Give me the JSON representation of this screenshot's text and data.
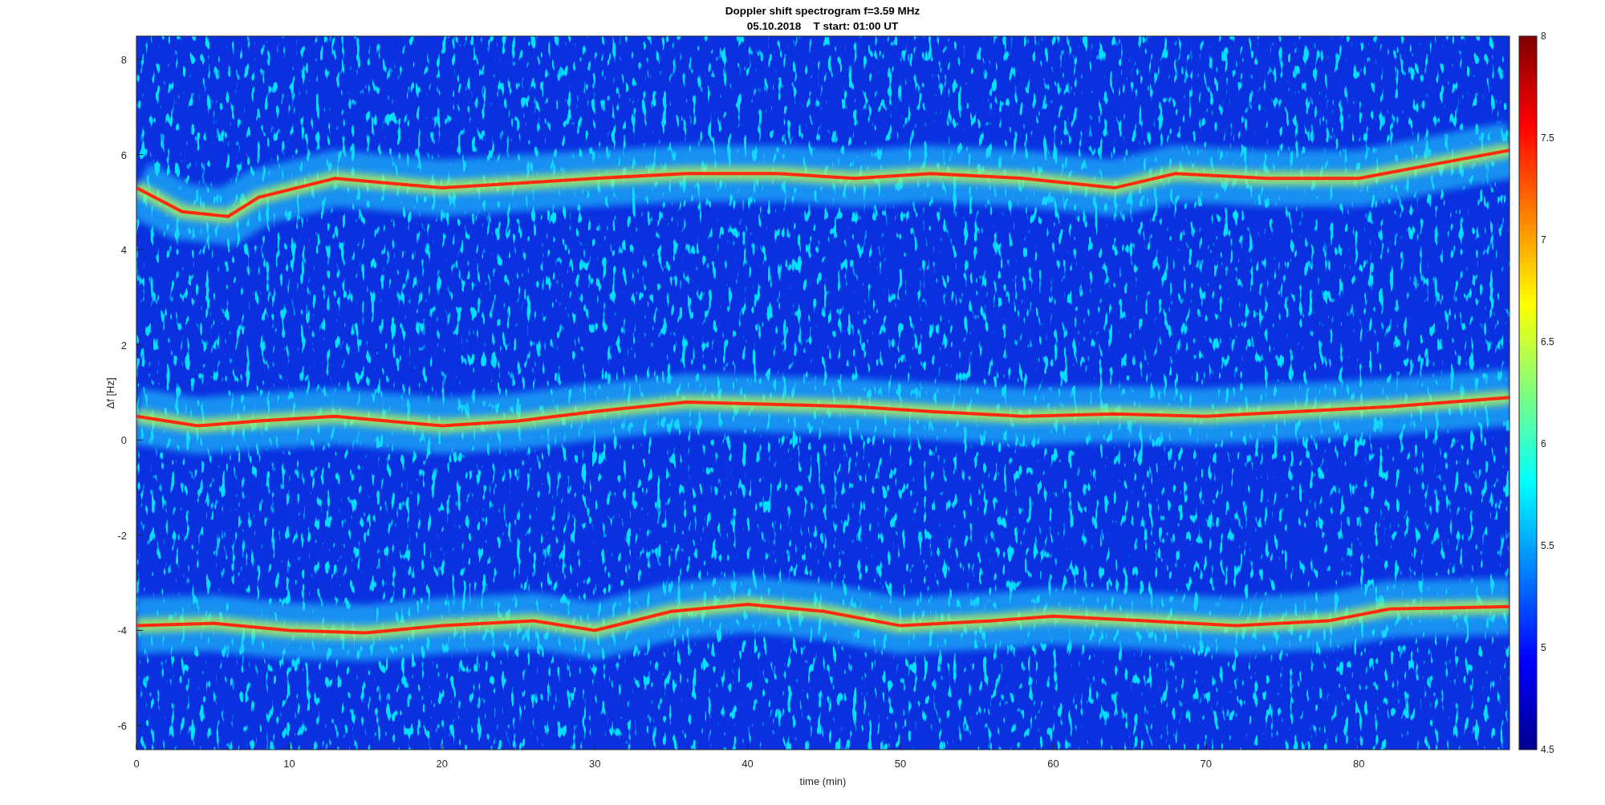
{
  "figure": {
    "title": "Doppler shift spectrogram f=3.59 MHz",
    "subtitle": "05.10.2018    T start: 01:00 UT",
    "xlabel": "time (min)",
    "ylabel": "Δf [Hz]",
    "xticks": [
      "0",
      "10",
      "20",
      "30",
      "40",
      "50",
      "60",
      "70",
      "80"
    ],
    "yticks": [
      "8",
      "6",
      "4",
      "2",
      "0",
      "-2",
      "-4",
      "-6"
    ],
    "colorbar_ticks": [
      "8",
      "7.5",
      "7",
      "6.5",
      "6",
      "5.5",
      "5",
      "4.5"
    ]
  }
}
